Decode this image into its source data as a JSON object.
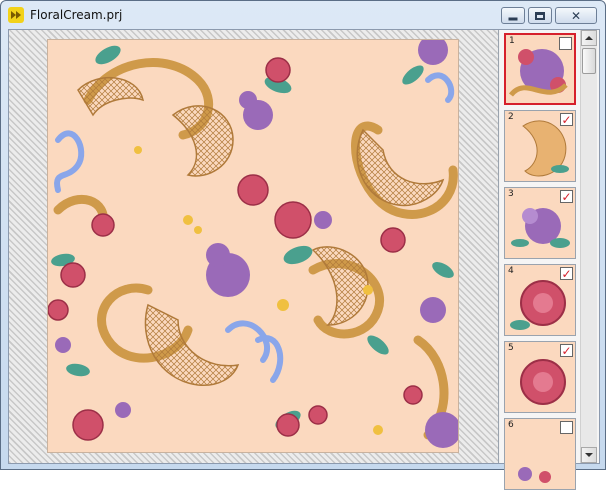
{
  "window": {
    "title": "FloralCream.prj"
  },
  "titlebar": {
    "app_icon": "yellow-double-arrow-icon",
    "controls": [
      "minimize",
      "maximize",
      "close"
    ]
  },
  "design": {
    "background_color": "#fbd9bf",
    "motif": "cross-stitch roses, violets, blue ribbons and gold rococo scrolls"
  },
  "thumbnails": [
    {
      "number": "1",
      "checked": false,
      "selected": true
    },
    {
      "number": "2",
      "checked": true,
      "selected": false
    },
    {
      "number": "3",
      "checked": true,
      "selected": false
    },
    {
      "number": "4",
      "checked": true,
      "selected": false
    },
    {
      "number": "5",
      "checked": true,
      "selected": false
    },
    {
      "number": "6",
      "checked": false,
      "selected": false
    }
  ],
  "colors": {
    "selection_border": "#d6202c",
    "check_mark": "#d6202c",
    "rose": "#d0506a",
    "violet": "#9a6ab8",
    "ribbon": "#8aa6ea",
    "scroll_gold": "#cf9a4a",
    "leaf": "#4aa08e"
  }
}
